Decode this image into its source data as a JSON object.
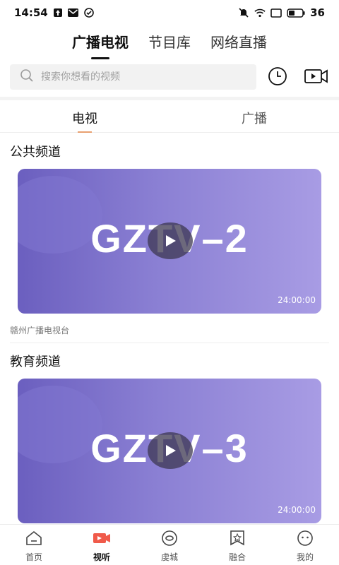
{
  "status_bar": {
    "time": "14:54",
    "battery": "36"
  },
  "top_tabs": [
    {
      "label": "广播电视",
      "active": true
    },
    {
      "label": "节目库",
      "active": false
    },
    {
      "label": "网络直播",
      "active": false
    }
  ],
  "search": {
    "placeholder": "搜索你想看的视频"
  },
  "sub_tabs": [
    {
      "label": "电视",
      "active": true
    },
    {
      "label": "广播",
      "active": false
    }
  ],
  "channels": [
    {
      "title": "公共频道",
      "logo_text": "GZTV–2",
      "duration": "24:00:00",
      "source": "赣州广播电视台"
    },
    {
      "title": "教育频道",
      "logo_text": "GZTV–3",
      "duration": "24:00:00"
    }
  ],
  "bottom_nav": [
    {
      "label": "首页",
      "icon": "home-icon",
      "active": false
    },
    {
      "label": "视听",
      "icon": "video-play-icon",
      "active": true
    },
    {
      "label": "虔城",
      "icon": "eye-icon",
      "active": false
    },
    {
      "label": "融合",
      "icon": "star-bookmark-icon",
      "active": false
    },
    {
      "label": "我的",
      "icon": "profile-face-icon",
      "active": false
    }
  ],
  "colors": {
    "accent": "#e8a070",
    "card_gradient_start": "#6b5fbf",
    "card_gradient_end": "#a89ce4",
    "nav_active_red": "#f05a4a"
  }
}
